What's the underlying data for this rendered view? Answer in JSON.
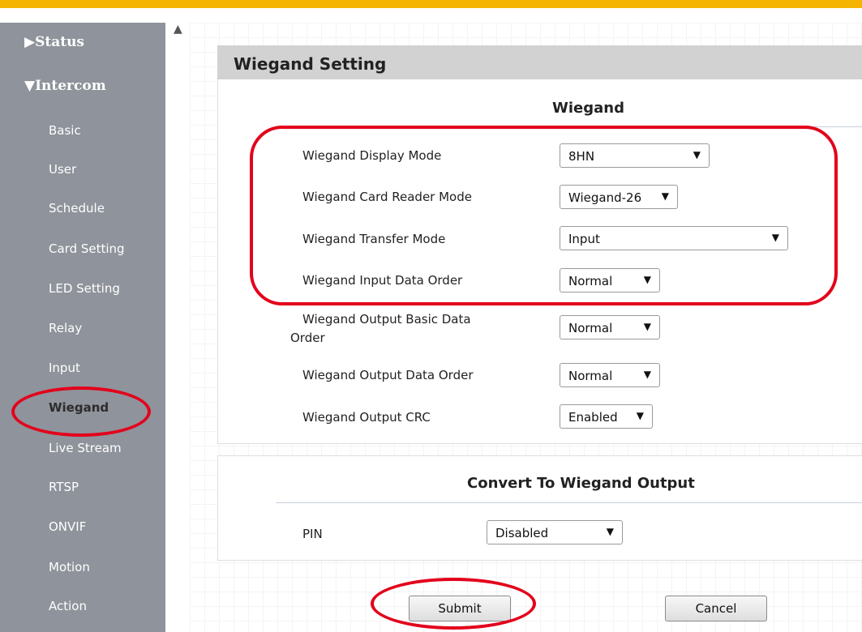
{
  "sidebar": {
    "status_label": "Status",
    "intercom_label": "Intercom",
    "items": [
      {
        "label": "Basic"
      },
      {
        "label": "User"
      },
      {
        "label": "Schedule"
      },
      {
        "label": "Card Setting"
      },
      {
        "label": "LED Setting"
      },
      {
        "label": "Relay"
      },
      {
        "label": "Input"
      },
      {
        "label": "Wiegand"
      },
      {
        "label": "Live Stream"
      },
      {
        "label": "RTSP"
      },
      {
        "label": "ONVIF"
      },
      {
        "label": "Motion"
      },
      {
        "label": "Action"
      }
    ],
    "active": "Wiegand"
  },
  "panel": {
    "title": "Wiegand Setting",
    "section_title": "Wiegand",
    "rows": [
      {
        "label": "Wiegand Display Mode",
        "value": "8HN"
      },
      {
        "label": "Wiegand Card Reader Mode",
        "value": "Wiegand-26"
      },
      {
        "label": "Wiegand Transfer Mode",
        "value": "Input"
      },
      {
        "label": "Wiegand Input Data Order",
        "value": "Normal"
      },
      {
        "label_line1": "Wiegand Output Basic Data",
        "label_line2": "Order",
        "value": "Normal"
      },
      {
        "label": "Wiegand Output Data Order",
        "value": "Normal"
      },
      {
        "label": "Wiegand Output CRC",
        "value": "Enabled"
      }
    ]
  },
  "convert": {
    "title": "Convert To Wiegand Output",
    "pin_label": "PIN",
    "pin_value": "Disabled"
  },
  "actions": {
    "submit_label": "Submit",
    "cancel_label": "Cancel"
  },
  "colors": {
    "accent": "#f5b400",
    "sidebar_bg": "#8f939b",
    "annotation": "#e3001b"
  }
}
